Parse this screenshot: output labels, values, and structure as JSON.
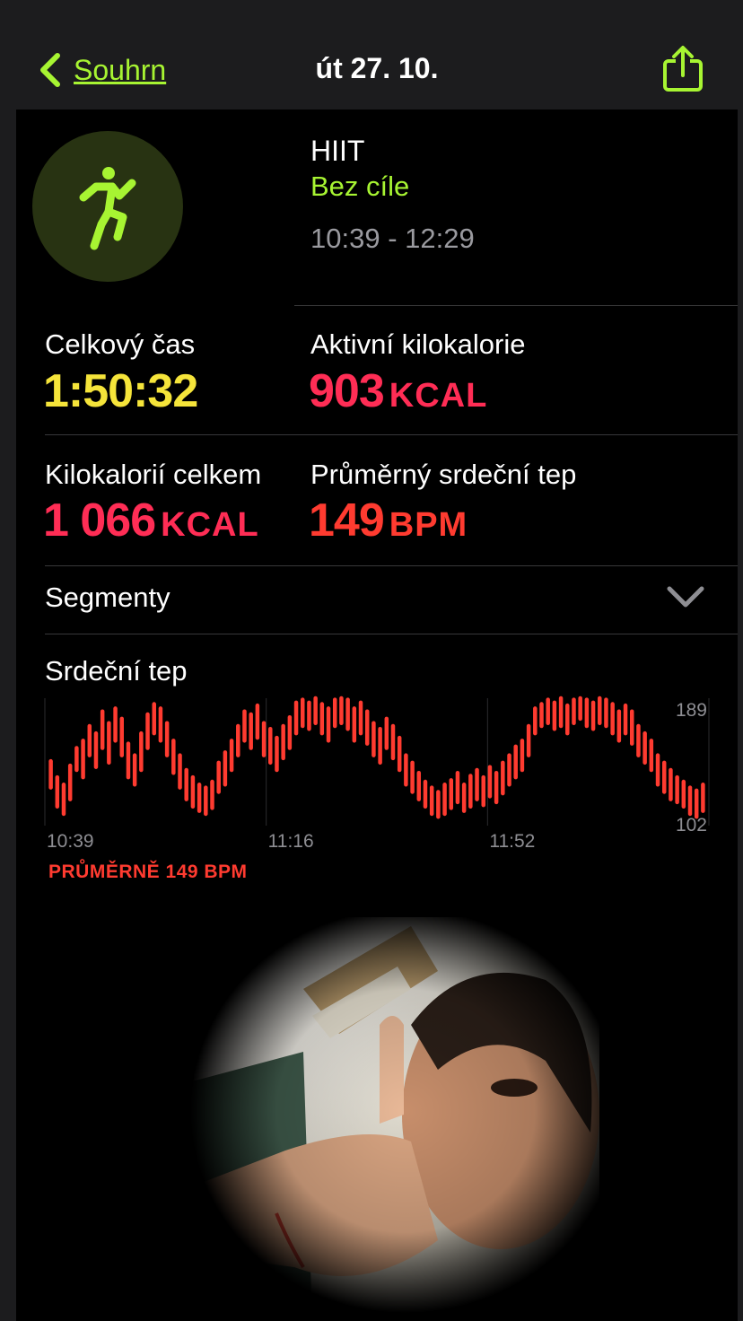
{
  "nav": {
    "back_label": "Souhrn",
    "title": "út 27. 10.",
    "share_icon": "share-icon"
  },
  "workout": {
    "name": "HIIT",
    "goal": "Bez cíle",
    "time_range": "10:39 - 12:29",
    "icon": "running-figure-icon"
  },
  "metrics": [
    {
      "label": "Celkový čas",
      "value": "1:50:32",
      "unit": "",
      "color": "#f5e43a"
    },
    {
      "label": "Aktivní kilokalorie",
      "value": "903",
      "unit": "KCAL",
      "color": "#ff2d55"
    },
    {
      "label": "Kilokalorií celkem",
      "value": "1 066",
      "unit": "KCAL",
      "color": "#ff2d55"
    },
    {
      "label": "Průměrný srdeční tep",
      "value": "149",
      "unit": "BPM",
      "color": "#ff3b30"
    }
  ],
  "segments": {
    "label": "Segmenty",
    "icon": "chevron-down-icon"
  },
  "heart_rate": {
    "title": "Srdeční tep",
    "avg_label": "PRŮMĚRNĚ 149 BPM",
    "color": "#ff3b30"
  },
  "chart_data": {
    "type": "bar",
    "title": "Srdeční tep",
    "x_tick_labels": [
      "10:39",
      "11:16",
      "11:52"
    ],
    "y_tick_labels": [
      "189",
      "102"
    ],
    "ylim": [
      102,
      189
    ],
    "x_domain": [
      "10:39",
      "12:29"
    ],
    "grid": true,
    "series": [
      {
        "values": [
          [
            128,
            146
          ],
          [
            115,
            135
          ],
          [
            110,
            130
          ],
          [
            120,
            143
          ],
          [
            140,
            155
          ],
          [
            135,
            160
          ],
          [
            150,
            170
          ],
          [
            142,
            165
          ],
          [
            155,
            180
          ],
          [
            145,
            172
          ],
          [
            160,
            182
          ],
          [
            150,
            175
          ],
          [
            135,
            158
          ],
          [
            130,
            150
          ],
          [
            140,
            165
          ],
          [
            155,
            178
          ],
          [
            165,
            185
          ],
          [
            160,
            182
          ],
          [
            150,
            172
          ],
          [
            138,
            160
          ],
          [
            128,
            150
          ],
          [
            120,
            140
          ],
          [
            115,
            135
          ],
          [
            112,
            130
          ],
          [
            110,
            128
          ],
          [
            114,
            132
          ],
          [
            125,
            145
          ],
          [
            130,
            152
          ],
          [
            140,
            160
          ],
          [
            150,
            170
          ],
          [
            160,
            180
          ],
          [
            155,
            178
          ],
          [
            162,
            184
          ],
          [
            150,
            172
          ],
          [
            145,
            168
          ],
          [
            140,
            162
          ],
          [
            148,
            170
          ],
          [
            155,
            176
          ],
          [
            165,
            186
          ],
          [
            170,
            188
          ],
          [
            168,
            186
          ],
          [
            172,
            189
          ],
          [
            165,
            185
          ],
          [
            160,
            182
          ],
          [
            170,
            188
          ],
          [
            172,
            189
          ],
          [
            168,
            188
          ],
          [
            160,
            182
          ],
          [
            165,
            186
          ],
          [
            158,
            180
          ],
          [
            150,
            172
          ],
          [
            145,
            168
          ],
          [
            155,
            175
          ],
          [
            148,
            170
          ],
          [
            140,
            162
          ],
          [
            130,
            150
          ],
          [
            125,
            145
          ],
          [
            120,
            138
          ],
          [
            115,
            132
          ],
          [
            110,
            128
          ],
          [
            108,
            125
          ],
          [
            110,
            130
          ],
          [
            114,
            133
          ],
          [
            118,
            138
          ],
          [
            112,
            130
          ],
          [
            115,
            136
          ],
          [
            120,
            140
          ],
          [
            116,
            135
          ],
          [
            122,
            142
          ],
          [
            118,
            138
          ],
          [
            124,
            145
          ],
          [
            130,
            150
          ],
          [
            135,
            156
          ],
          [
            140,
            160
          ],
          [
            150,
            170
          ],
          [
            165,
            182
          ],
          [
            170,
            185
          ],
          [
            172,
            188
          ],
          [
            168,
            186
          ],
          [
            170,
            189
          ],
          [
            165,
            184
          ],
          [
            172,
            188
          ],
          [
            175,
            189
          ],
          [
            170,
            188
          ],
          [
            168,
            186
          ],
          [
            172,
            189
          ],
          [
            170,
            188
          ],
          [
            165,
            185
          ],
          [
            160,
            180
          ],
          [
            165,
            184
          ],
          [
            158,
            180
          ],
          [
            150,
            170
          ],
          [
            145,
            165
          ],
          [
            140,
            160
          ],
          [
            130,
            150
          ],
          [
            125,
            145
          ],
          [
            120,
            140
          ],
          [
            118,
            135
          ],
          [
            115,
            132
          ],
          [
            110,
            128
          ],
          [
            108,
            126
          ],
          [
            112,
            130
          ]
        ]
      }
    ]
  }
}
